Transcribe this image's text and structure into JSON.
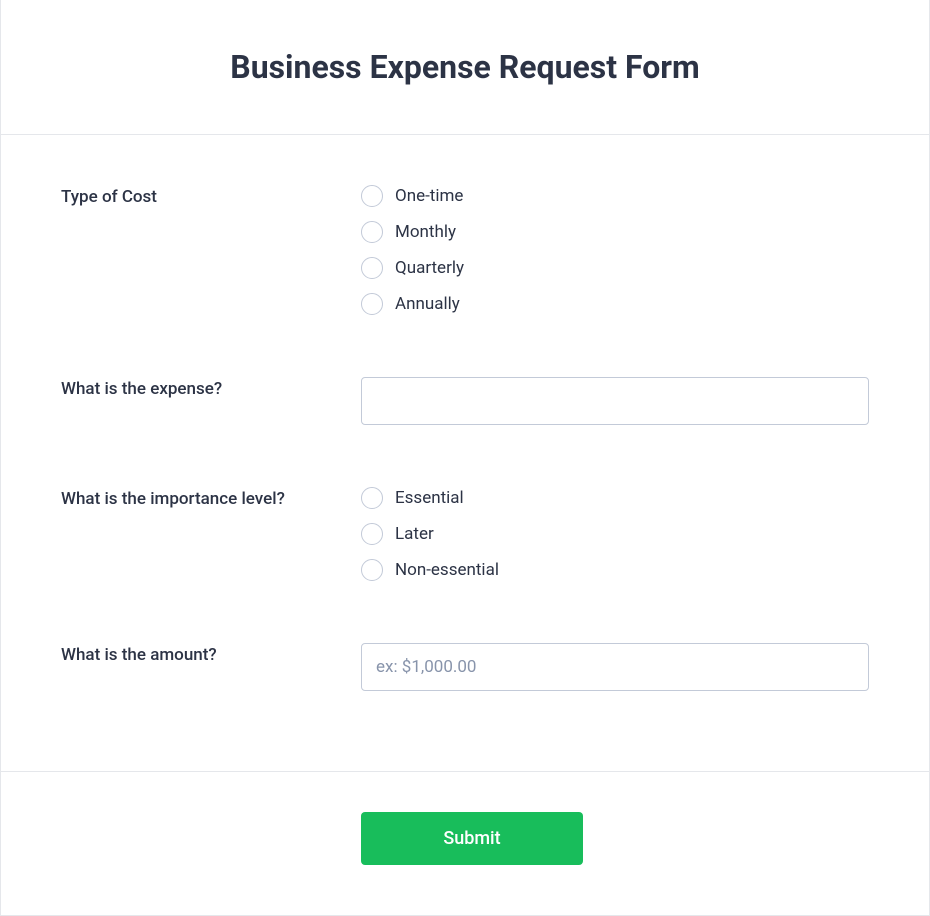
{
  "header": {
    "title": "Business Expense Request Form"
  },
  "fields": {
    "costType": {
      "label": "Type of Cost",
      "options": [
        "One-time",
        "Monthly",
        "Quarterly",
        "Annually"
      ]
    },
    "expense": {
      "label": "What is the expense?",
      "value": ""
    },
    "importance": {
      "label": "What is the importance level?",
      "options": [
        "Essential",
        "Later",
        "Non-essential"
      ]
    },
    "amount": {
      "label": "What is the amount?",
      "placeholder": "ex: $1,000.00",
      "value": ""
    }
  },
  "footer": {
    "submit_label": "Submit"
  }
}
